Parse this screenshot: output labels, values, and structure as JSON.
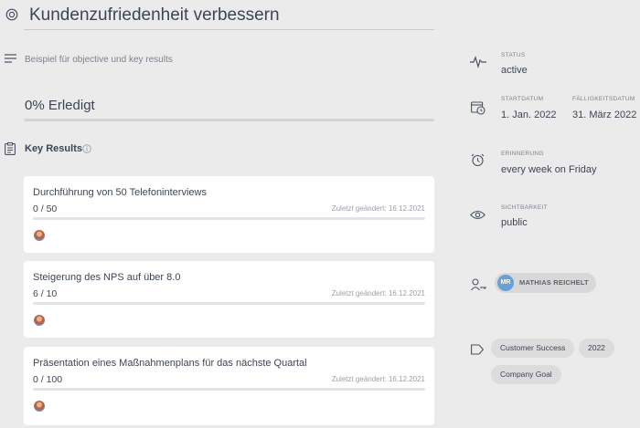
{
  "objective": {
    "title": "Kundenzufriedenheit verbessern",
    "description": "Beispiel für objective und key results",
    "progress_label": "0% Erledigt",
    "progress": 0
  },
  "key_results": {
    "heading": "Key Results",
    "items": [
      {
        "title": "Durchführung von 50 Telefoninterviews",
        "value": "0 / 50",
        "changed": "Zuletzt geändert: 16.12.2021",
        "progress": 0
      },
      {
        "title": "Steigerung des NPS auf über 8.0",
        "value": "6 / 10",
        "changed": "Zuletzt geändert: 16.12.2021",
        "progress": 0
      },
      {
        "title": "Präsentation eines Maßnahmenplans für das nächste Quartal",
        "value": "0 / 100",
        "changed": "Zuletzt geändert: 16.12.2021",
        "progress": 0
      }
    ]
  },
  "sidebar": {
    "status_label": "STATUS",
    "status_value": "active",
    "start_label": "STARTDATUM",
    "start_value": "1. Jan. 2022",
    "due_label": "FÄLLIGKEITSDATUM",
    "due_value": "31. März 2022",
    "reminder_label": "ERINNERUNG",
    "reminder_value": "every week on Friday",
    "visibility_label": "SICHTBARKEIT",
    "visibility_value": "public",
    "member_initials": "MR",
    "member_name": "MATHIAS REICHELT",
    "tags": [
      "Customer Success",
      "2022",
      "Company Goal"
    ]
  },
  "colors": {
    "background": "#ebebeb",
    "card": "#ffffff",
    "accent": "#8bb3d9",
    "member_avatar": "#6aa0d8"
  },
  "icons": [
    "target-icon",
    "lines-icon",
    "clipboard-icon",
    "info-icon",
    "pulse-icon",
    "calendar-clock-icon",
    "alarm-icon",
    "eye-icon",
    "user-key-icon",
    "tag-icon"
  ]
}
